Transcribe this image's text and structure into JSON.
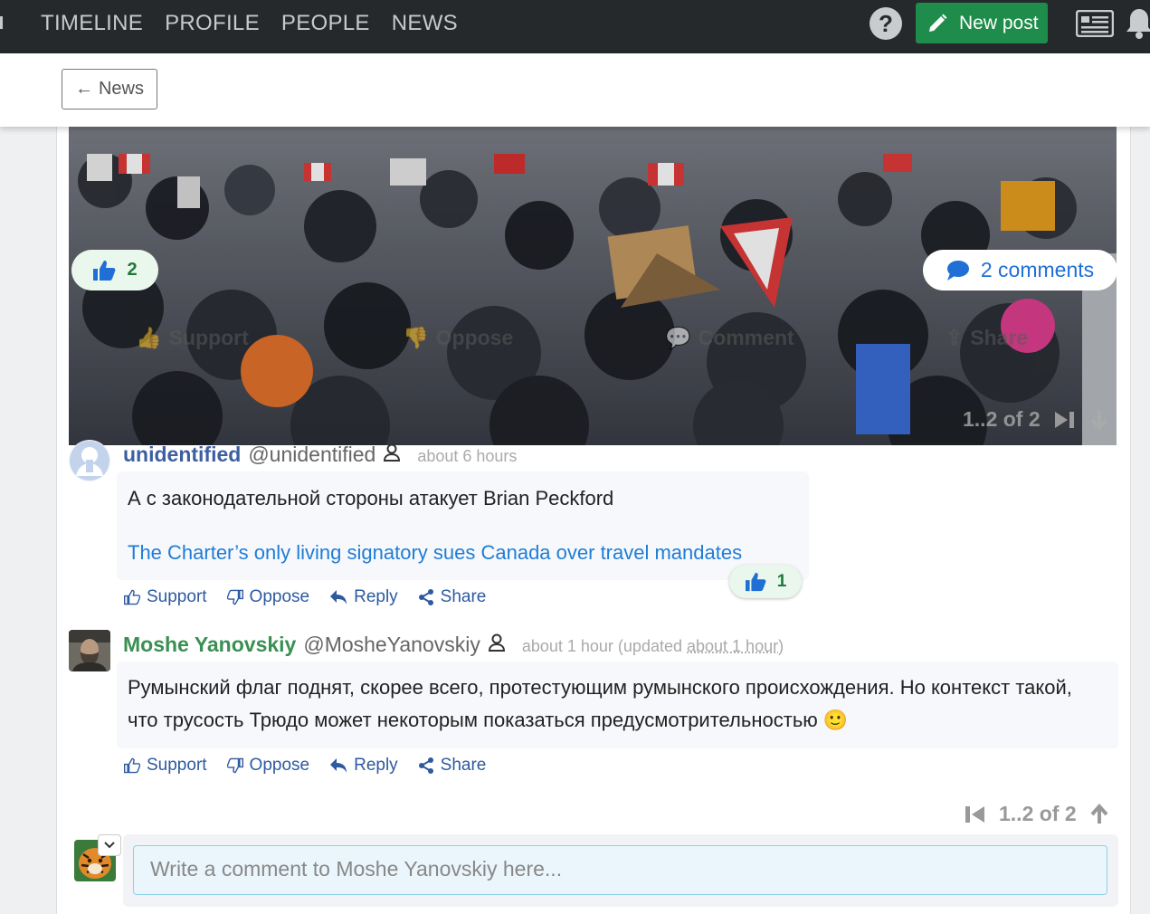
{
  "nav": {
    "items": [
      "TIMELINE",
      "PROFILE",
      "PEOPLE",
      "NEWS"
    ],
    "help_label": "?",
    "new_post_label": "New post"
  },
  "subbar": {
    "back_label": "News",
    "back_arrow": "←"
  },
  "post": {
    "like_count": "2",
    "comments_label": "2 comments",
    "actions": {
      "support": "Support",
      "oppose": "Oppose",
      "comment": "Comment",
      "share": "Share"
    },
    "pager": "1..2 of 2"
  },
  "comments": [
    {
      "author": "unidentified",
      "handle": "@unidentified",
      "time": "about 6 hours",
      "text": "А с законодательной стороны атакует Brian Peckford",
      "link": "The Charter’s only living signatory sues Canada over travel mandates",
      "likes": "1",
      "author_color": "#3d5fa0"
    },
    {
      "author": "Moshe Yanovskiy",
      "handle": "@MosheYanovskiy",
      "time_prefix": "about 1 hour (updated ",
      "time_updated": "about 1 hour",
      "time_suffix": ")",
      "text": "Румынский флаг поднят, скорее всего, протестующим румынского происхождения. Но контекст такой, что трусость Трюдо может некоторым показаться предусмотрительностью 🙂",
      "author_color": "#3a8f52"
    }
  ],
  "comment_actions": {
    "support": "Support",
    "oppose": "Oppose",
    "reply": "Reply",
    "share": "Share"
  },
  "pager": "1..2 of 2",
  "composer": {
    "placeholder": "Write a comment to Moshe Yanovskiy here..."
  },
  "colors": {
    "nav_bg": "#25292c",
    "primary_green": "#1e8c4a",
    "link_blue": "#1f7dd6",
    "action_blue": "#2e5aa0"
  }
}
